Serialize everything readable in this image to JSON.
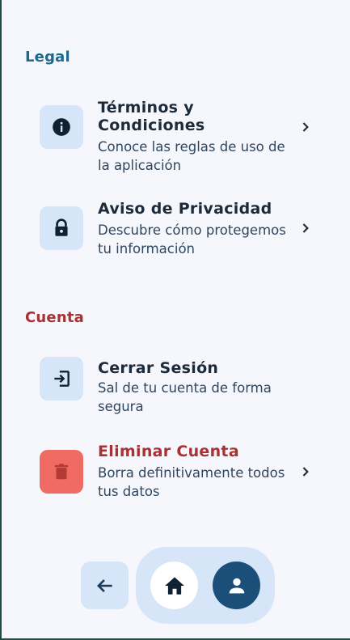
{
  "sections": {
    "legal": {
      "title": "Legal",
      "color": "#1b6a8e"
    },
    "account": {
      "title": "Cuenta",
      "color": "#a83232"
    }
  },
  "items": [
    {
      "title": "Términos y Condiciones",
      "description": "Conoce las reglas de uso de la aplicación",
      "icon": "info-icon"
    },
    {
      "title": "Aviso de Privacidad",
      "description": "Descubre cómo protegemos tu información",
      "icon": "lock-icon"
    },
    {
      "title": "Cerrar Sesión",
      "description": "Sal de tu cuenta de forma segura",
      "icon": "logout-icon"
    },
    {
      "title": "Eliminar Cuenta",
      "description": "Borra definitivamente todos tus datos",
      "icon": "trash-icon",
      "danger_color": "#a83232"
    }
  ],
  "nav": {
    "back_icon": "arrow-left-icon",
    "home_icon": "home-icon",
    "profile_icon": "person-icon"
  },
  "colors": {
    "icon_bg": "#d7e5f8",
    "danger_icon_bg": "#f06b64",
    "nav_active": "#1b4f7a"
  }
}
